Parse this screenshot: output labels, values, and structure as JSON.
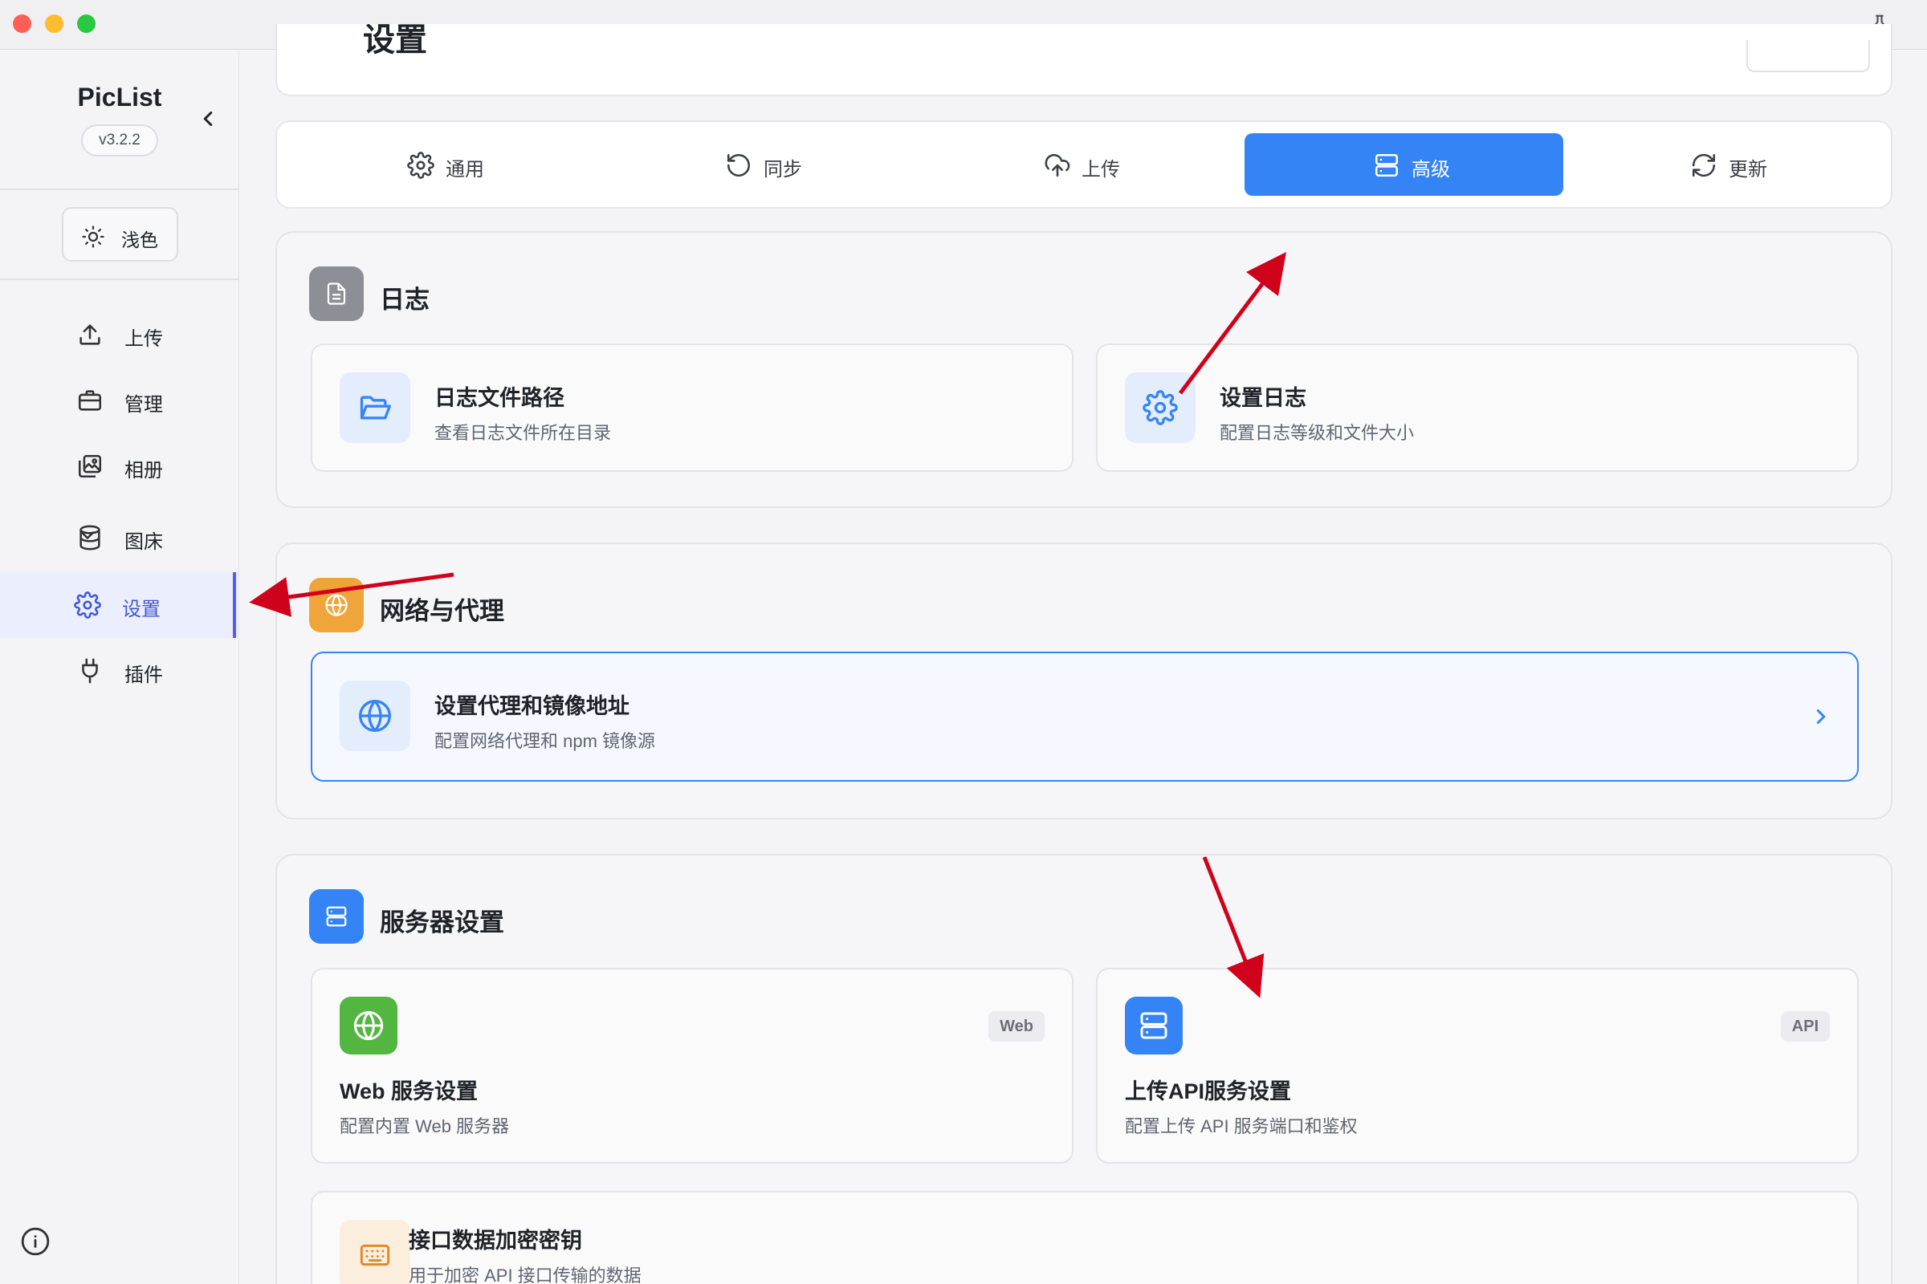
{
  "window": {
    "controls": [
      "close",
      "minimize",
      "maximize"
    ],
    "pin_icon": "pin-icon"
  },
  "sidebar": {
    "app_name": "PicList",
    "version": "v3.2.2",
    "theme_label": "浅色",
    "items": [
      {
        "label": "上传",
        "icon": "upload-icon"
      },
      {
        "label": "管理",
        "icon": "briefcase-icon"
      },
      {
        "label": "相册",
        "icon": "gallery-icon"
      },
      {
        "label": "图床",
        "icon": "database-icon"
      },
      {
        "label": "设置",
        "icon": "gear-icon",
        "active": true
      },
      {
        "label": "插件",
        "icon": "plug-icon"
      }
    ]
  },
  "header": {
    "title_partial": "设置"
  },
  "tabs": [
    {
      "label": "通用",
      "icon": "gear-icon"
    },
    {
      "label": "同步",
      "icon": "history-icon"
    },
    {
      "label": "上传",
      "icon": "cloud-upload-icon"
    },
    {
      "label": "高级",
      "icon": "server-icon",
      "active": true
    },
    {
      "label": "更新",
      "icon": "refresh-icon"
    }
  ],
  "sections": {
    "log": {
      "title": "日志",
      "items": [
        {
          "title": "日志文件路径",
          "desc": "查看日志文件所在目录"
        },
        {
          "title": "设置日志",
          "desc": "配置日志等级和文件大小"
        }
      ]
    },
    "network": {
      "title": "网络与代理",
      "item": {
        "title": "设置代理和镜像地址",
        "desc": "配置网络代理和 npm 镜像源"
      }
    },
    "server": {
      "title": "服务器设置",
      "items": [
        {
          "title": "Web 服务设置",
          "desc": "配置内置 Web 服务器",
          "badge": "Web"
        },
        {
          "title": "上传API服务设置",
          "desc": "配置上传 API 服务端口和鉴权",
          "badge": "API"
        }
      ],
      "extra": {
        "title": "接口数据加密密钥",
        "desc": "用于加密 API 接口传输的数据"
      }
    }
  },
  "colors": {
    "accent": "#3584f6",
    "sidebar_active": "#4158d4",
    "annotation_arrow": "#d0021b"
  }
}
